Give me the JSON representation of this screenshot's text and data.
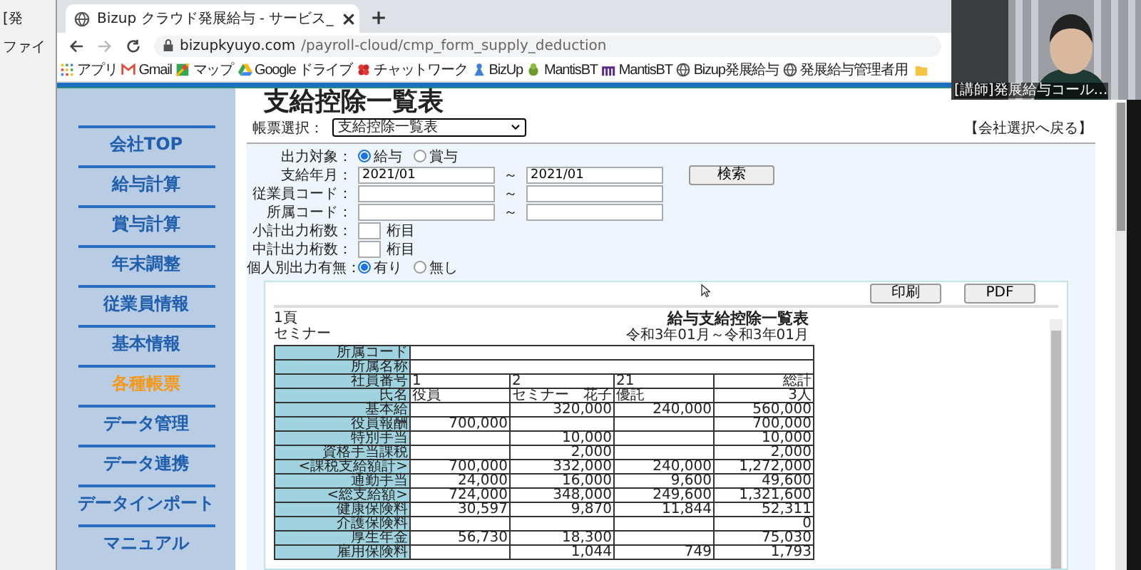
{
  "left_window": {
    "tab": "[発",
    "menu": "ファイ"
  },
  "browser": {
    "tab": {
      "title": "Bizup クラウド発展給与 - サービス_",
      "selected": true
    },
    "url_host": "bizupkyuyo.com",
    "url_path": "/payroll-cloud/cmp_form_supply_deduction",
    "bookmarks": [
      {
        "label": "アプリ",
        "kind": "apps"
      },
      {
        "label": "Gmail",
        "kind": "gmail"
      },
      {
        "label": "マップ",
        "kind": "maps"
      },
      {
        "label": "Google ドライブ",
        "kind": "drive"
      },
      {
        "label": "チャットワーク",
        "kind": "chat"
      },
      {
        "label": "BizUp",
        "kind": "bizup"
      },
      {
        "label": "MantisBT",
        "kind": "mantis"
      },
      {
        "label": "MantisBT",
        "kind": "m"
      },
      {
        "label": "Bizup発展給与",
        "kind": "globe"
      },
      {
        "label": "発展給与管理者用",
        "kind": "globe"
      }
    ]
  },
  "video_tile": {
    "name": "[講師]発展給与コール…"
  },
  "sidebar": {
    "items": [
      {
        "label": "会社TOP",
        "selected": false
      },
      {
        "label": "給与計算",
        "selected": false
      },
      {
        "label": "賞与計算",
        "selected": false
      },
      {
        "label": "年末調整",
        "selected": false
      },
      {
        "label": "従業員情報",
        "selected": false
      },
      {
        "label": "基本情報",
        "selected": false
      },
      {
        "label": "各種帳票",
        "selected": true
      },
      {
        "label": "データ管理",
        "selected": false
      },
      {
        "label": "データ連携",
        "selected": false
      },
      {
        "label": "データインポート",
        "selected": false
      },
      {
        "label": "マニュアル",
        "selected": false
      }
    ]
  },
  "page": {
    "title": "支給控除一覧表",
    "back_link": "【会社選択へ戻る】",
    "report_select": {
      "label": "帳票選択：",
      "value": "支給控除一覧表"
    }
  },
  "form": {
    "search_button": "検索",
    "rows": [
      {
        "kind": "radio",
        "label": "出力対象：",
        "options": [
          {
            "label": "給与",
            "selected": true
          },
          {
            "label": "賞与",
            "selected": false
          }
        ]
      },
      {
        "kind": "range",
        "label": "支給年月：",
        "from": "2021/01",
        "to": "2021/01",
        "separator": "～"
      },
      {
        "kind": "range",
        "label": "従業員コード：",
        "separator": "～"
      },
      {
        "kind": "range",
        "label": "所属コード：",
        "separator": "～"
      },
      {
        "kind": "digits",
        "label": "小計出力桁数：",
        "suffix": "桁目"
      },
      {
        "kind": "digits",
        "label": "中計出力桁数：",
        "suffix": "桁目"
      },
      {
        "kind": "radio",
        "label": "個人別出力有無：",
        "options": [
          {
            "label": "有り",
            "selected": true
          },
          {
            "label": "無し",
            "selected": false
          }
        ]
      }
    ]
  },
  "viewer": {
    "buttons": [
      "印刷",
      "PDF"
    ],
    "report": {
      "page": "1頁",
      "company": "セミナー",
      "title": "給与支給控除一覧表",
      "period": "令和3年01月～令和3年01月",
      "header_rows": [
        {
          "kind": "span",
          "label": "所属コード"
        },
        {
          "kind": "span",
          "label": "所属名称"
        },
        {
          "kind": "head",
          "label": "社員番号",
          "cells": [
            "1",
            "2",
            "21",
            "総計"
          ]
        },
        {
          "kind": "head",
          "label": "氏名",
          "cells": [
            "役員",
            "セミナー　花子",
            "優託",
            "3人"
          ]
        }
      ],
      "rows": [
        {
          "label": "基本給",
          "c2": "320,000",
          "c3": "240,000",
          "total": "560,000"
        },
        {
          "label": "役員報酬",
          "c1": "700,000",
          "total": "700,000"
        },
        {
          "label": "特別手当",
          "c2": "10,000",
          "total": "10,000"
        },
        {
          "label": "資格手当課税",
          "c2": "2,000",
          "total": "2,000"
        },
        {
          "label": "<課税支給額計>",
          "c1": "700,000",
          "c2": "332,000",
          "c3": "240,000",
          "total": "1,272,000"
        },
        {
          "label": "通勤手当",
          "c1": "24,000",
          "c2": "16,000",
          "c3": "9,600",
          "total": "49,600"
        },
        {
          "label": "<総支給額>",
          "c1": "724,000",
          "c2": "348,000",
          "c3": "249,600",
          "total": "1,321,600"
        },
        {
          "label": "健康保険料",
          "c1": "30,597",
          "c2": "9,870",
          "c3": "11,844",
          "total": "52,311"
        },
        {
          "label": "介護保険料",
          "total": "0"
        },
        {
          "label": "厚生年金",
          "c1": "56,730",
          "c2": "18,300",
          "total": "75,030"
        },
        {
          "label": "雇用保険料",
          "c2": "1,044",
          "c3": "749",
          "total": "1,793"
        }
      ]
    }
  }
}
